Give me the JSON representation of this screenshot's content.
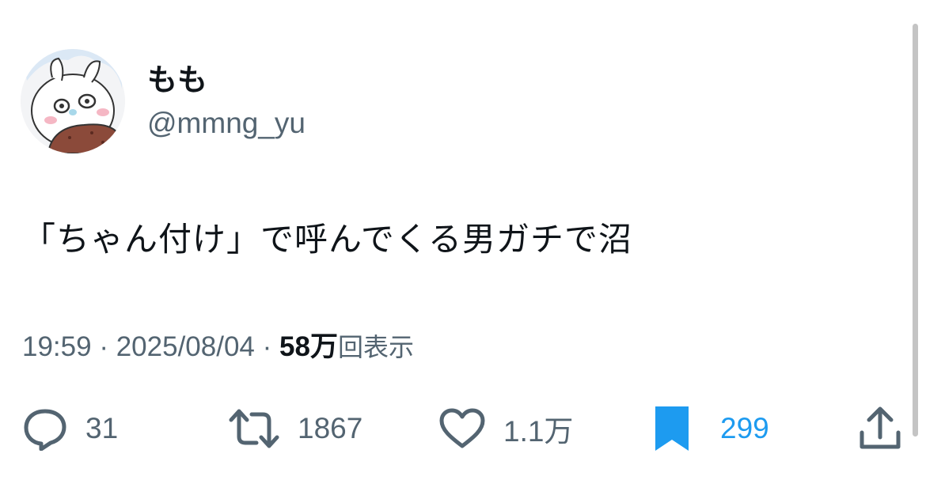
{
  "user": {
    "display_name": "もも",
    "handle": "@mmng_yu",
    "avatar_icon": "cartoon-bunny-avatar"
  },
  "tweet": {
    "text": "「ちゃん付け」で呼んでくる男ガチで沼"
  },
  "meta": {
    "time": "19:59",
    "separator": "·",
    "date": "2025/08/04",
    "views_count": "58万",
    "views_label": "回表示"
  },
  "actions": {
    "reply": {
      "icon": "reply-icon",
      "count": "31"
    },
    "retweet": {
      "icon": "retweet-icon",
      "count": "1867"
    },
    "like": {
      "icon": "heart-icon",
      "count": "1.1万"
    },
    "bookmark": {
      "icon": "bookmark-icon",
      "count": "299",
      "color": "#1d9bf0"
    },
    "share": {
      "icon": "share-icon"
    }
  },
  "colors": {
    "text_primary": "#0f1419",
    "text_secondary": "#536471",
    "accent": "#1d9bf0"
  }
}
